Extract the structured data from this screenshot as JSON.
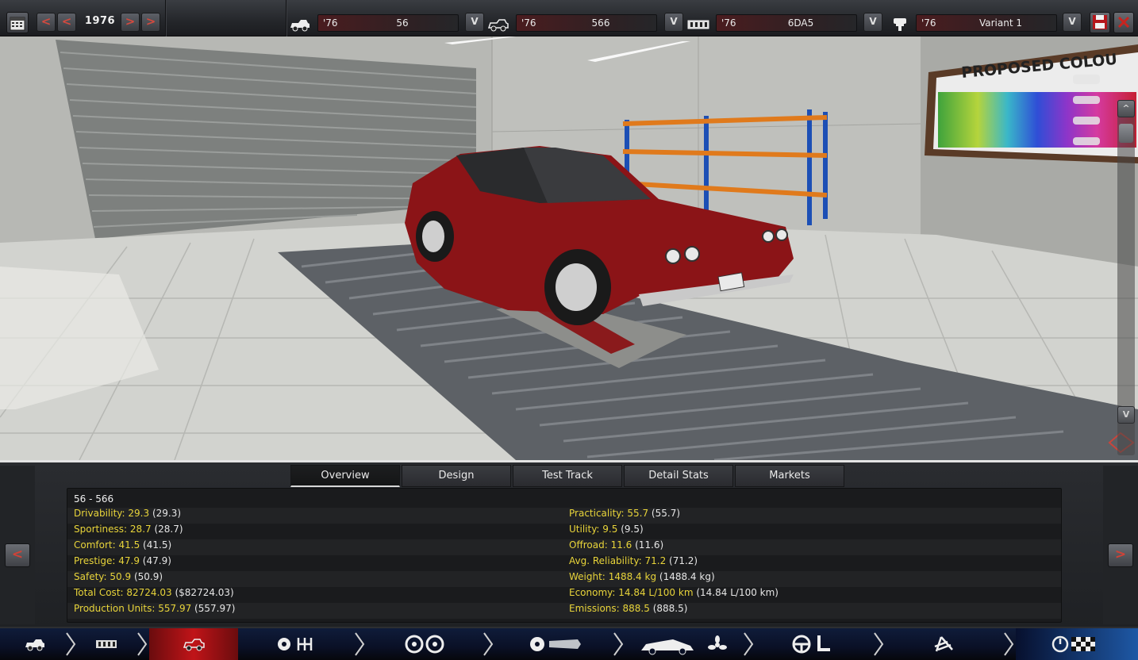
{
  "toolbar": {
    "year": "1976",
    "prev_label": "<",
    "next_label": ">",
    "dropdown_label": "V"
  },
  "selectors": {
    "model": {
      "year": "'76",
      "name": "56"
    },
    "trim": {
      "year": "'76",
      "name": "566"
    },
    "engine": {
      "year": "'76",
      "name": "6DA5"
    },
    "variant": {
      "year": "'76",
      "name": "Variant 1"
    }
  },
  "scene": {
    "wall_sign": "PROPOSED COLOU",
    "scroll_up": "^",
    "scroll_down": "V",
    "car_color": "#8b1417"
  },
  "tabs": [
    "Overview",
    "Design",
    "Test Track",
    "Detail Stats",
    "Markets"
  ],
  "active_tab": "Overview",
  "overview": {
    "title": "56 - 566",
    "left": [
      {
        "label": "Drivability:",
        "value": "29.3",
        "paren": "(29.3)"
      },
      {
        "label": "Sportiness:",
        "value": "28.7",
        "paren": "(28.7)"
      },
      {
        "label": "Comfort:",
        "value": "41.5",
        "paren": "(41.5)"
      },
      {
        "label": "Prestige:",
        "value": "47.9",
        "paren": "(47.9)"
      },
      {
        "label": "Safety:",
        "value": "50.9",
        "paren": "(50.9)"
      },
      {
        "label": "Total Cost:",
        "value": "82724.03",
        "paren": "($82724.03)"
      },
      {
        "label": "Production Units:",
        "value": "557.97",
        "paren": "(557.97)"
      }
    ],
    "right": [
      {
        "label": "Practicality:",
        "value": "55.7",
        "paren": "(55.7)"
      },
      {
        "label": "Utility:",
        "value": "9.5",
        "paren": "(9.5)"
      },
      {
        "label": "Offroad:",
        "value": "11.6",
        "paren": "(11.6)"
      },
      {
        "label": "Avg. Reliability:",
        "value": "71.2",
        "paren": "(71.2)"
      },
      {
        "label": "Weight:",
        "value": "1488.4 kg",
        "paren": "(1488.4 kg)"
      },
      {
        "label": "Economy:",
        "value": "14.84 L/100 km",
        "paren": "(14.84 L/100 km)"
      },
      {
        "label": "Emissions:",
        "value": "888.5",
        "paren": "(888.5)"
      }
    ]
  },
  "panel_nav": {
    "prev": "<",
    "next": ">"
  },
  "bottom_nav": [
    {
      "icon": "car-model-icon"
    },
    {
      "icon": "chassis-icon"
    },
    {
      "icon": "body-icon",
      "active": true
    },
    {
      "icon": "drivetrain-gearbox-icon"
    },
    {
      "icon": "wheels-brakes-icon"
    },
    {
      "icon": "aero-fixtures-icon"
    },
    {
      "icon": "interior-icon"
    },
    {
      "icon": "suspension-icon"
    },
    {
      "icon": "test-finish-icon"
    }
  ],
  "colors": {
    "accent_red": "#d34a3f",
    "stat_yellow": "#e8d43a",
    "active_nav": "#c01418"
  }
}
